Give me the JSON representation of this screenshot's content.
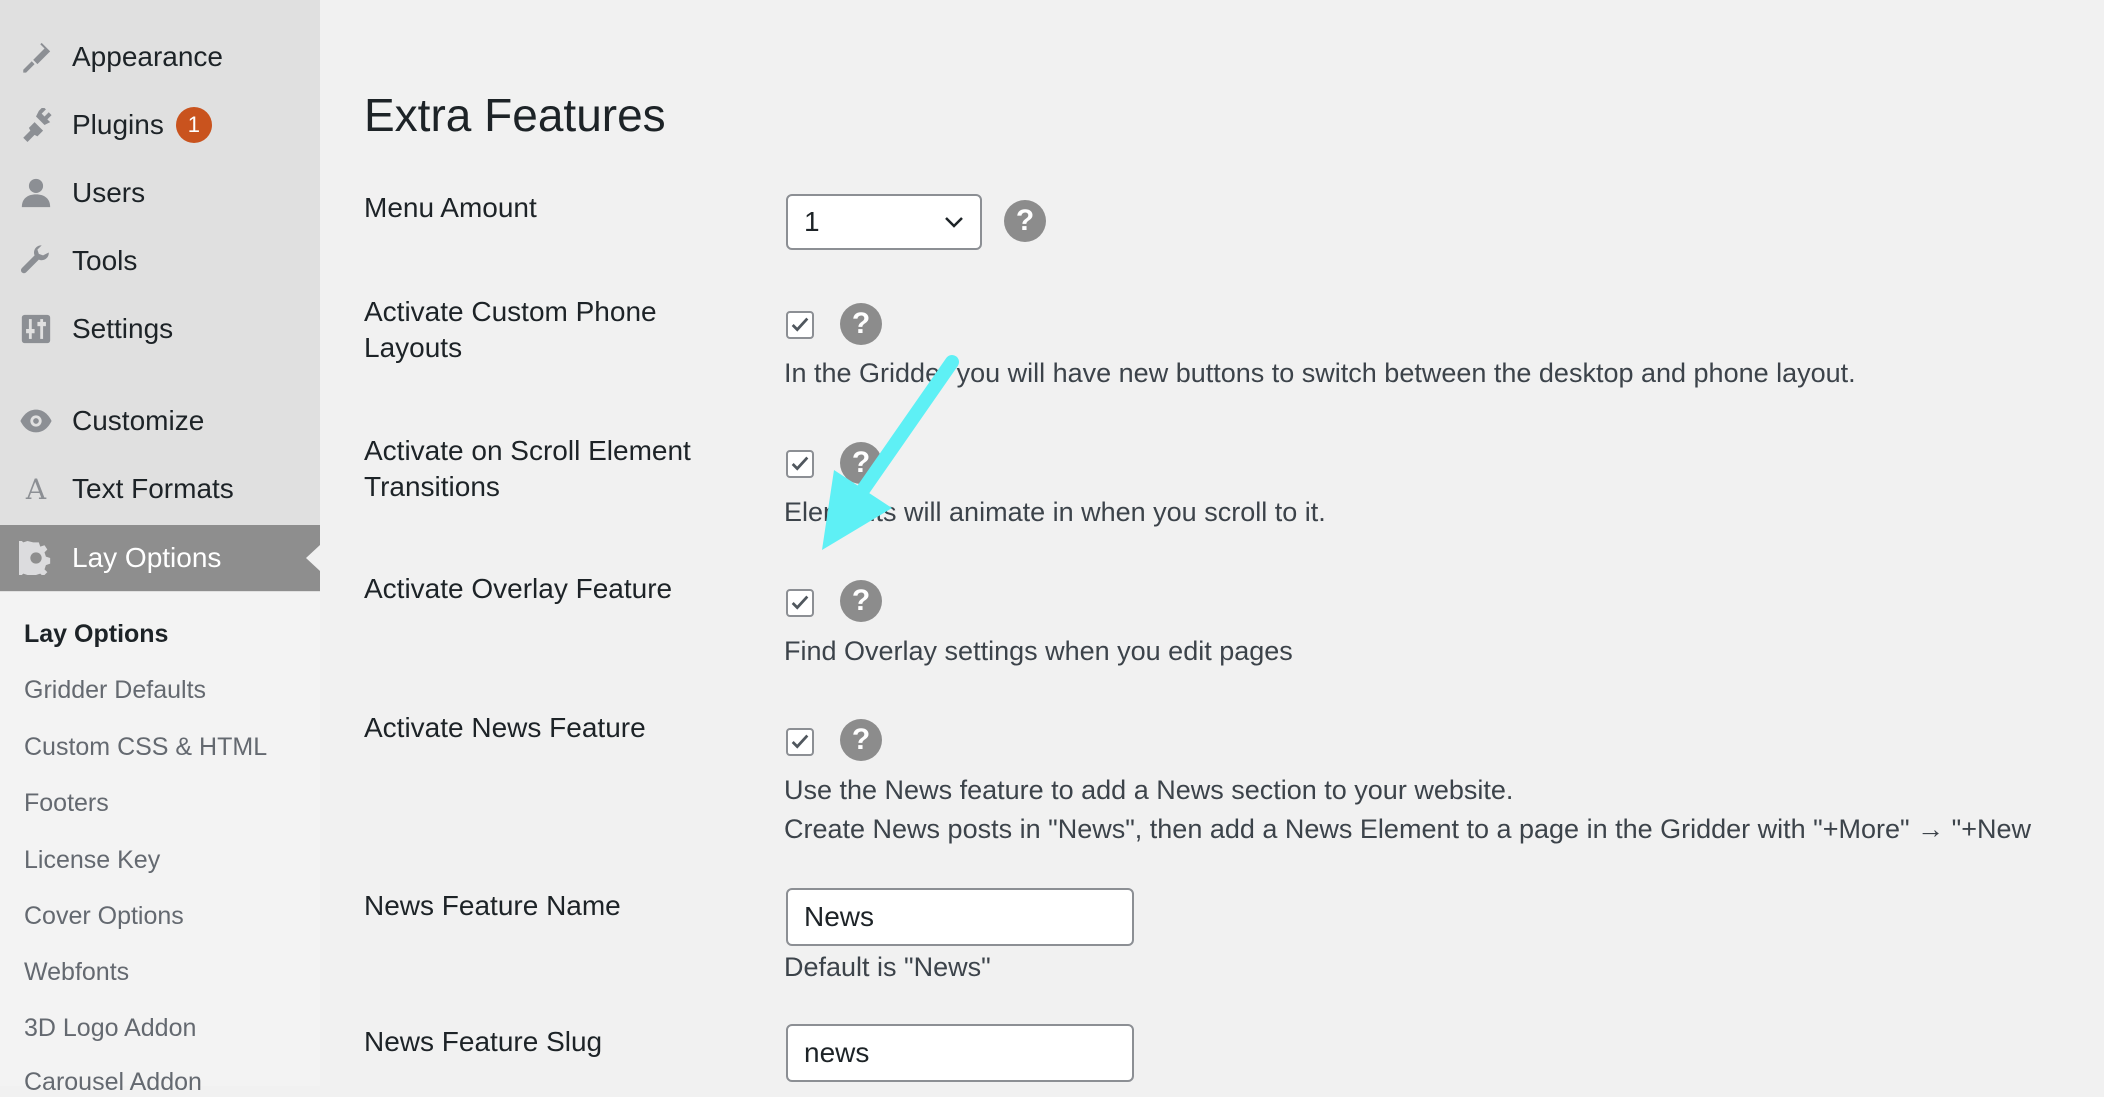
{
  "sidebar": {
    "menu": [
      {
        "label": "Appearance",
        "icon": "paintbrush-icon"
      },
      {
        "label": "Plugins",
        "icon": "plugin-icon",
        "badge": "1"
      },
      {
        "label": "Users",
        "icon": "user-icon"
      },
      {
        "label": "Tools",
        "icon": "wrench-icon"
      },
      {
        "label": "Settings",
        "icon": "sliders-icon"
      },
      {
        "label": "Customize",
        "icon": "eye-icon"
      },
      {
        "label": "Text Formats",
        "icon": "letter-a-icon",
        "glyph": "A"
      },
      {
        "label": "Lay Options",
        "icon": "gear-icon",
        "active": true
      }
    ],
    "submenu": [
      {
        "label": "Lay Options",
        "current": true
      },
      {
        "label": "Gridder Defaults"
      },
      {
        "label": "Custom CSS & HTML"
      },
      {
        "label": "Footers"
      },
      {
        "label": "License Key"
      },
      {
        "label": "Cover Options"
      },
      {
        "label": "Webfonts"
      },
      {
        "label": "3D Logo Addon"
      },
      {
        "label": "Carousel Addon"
      }
    ]
  },
  "main": {
    "title": "Extra Features",
    "menu_amount": {
      "label": "Menu Amount",
      "value": "1"
    },
    "custom_phone": {
      "label_line1": "Activate Custom Phone",
      "label_line2": "Layouts",
      "checked": true,
      "description": "In the Gridder you will have new buttons to switch between the desktop and phone layout."
    },
    "scroll_transitions": {
      "label_line1": "Activate on Scroll Element",
      "label_line2": "Transitions",
      "checked": true,
      "description": "Elements will animate in when you scroll to it."
    },
    "overlay": {
      "label": "Activate Overlay Feature",
      "checked": true,
      "description": "Find Overlay settings when you edit pages"
    },
    "news": {
      "label": "Activate News Feature",
      "checked": true,
      "description_line1": "Use the News feature to add a News section to your website.",
      "description_line2": "Create News posts in \"News\", then add a News Element to a page in the Gridder with \"+More\" → \"+New"
    },
    "news_name": {
      "label": "News Feature Name",
      "value": "News",
      "hint": "Default is \"News\""
    },
    "news_slug": {
      "label": "News Feature Slug",
      "value": "news"
    },
    "help_glyph": "?"
  },
  "colors": {
    "annotation_arrow": "#5ef0f5",
    "badge": "#c9531e",
    "active_menu_bg": "#8e8e8e"
  }
}
